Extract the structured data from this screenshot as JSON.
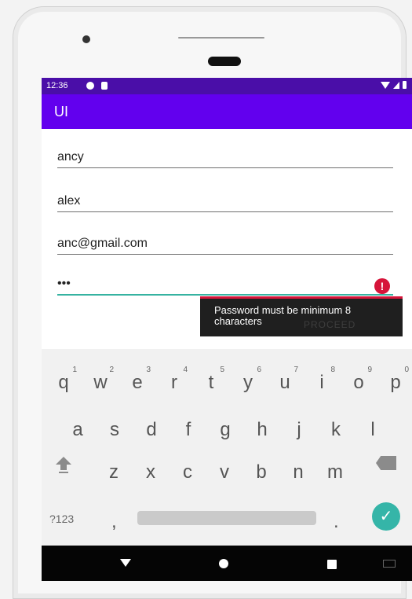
{
  "status_bar": {
    "time": "12:36"
  },
  "app_bar": {
    "title": "UI"
  },
  "form": {
    "fields": [
      {
        "value": "ancy"
      },
      {
        "value": "alex"
      },
      {
        "value": "anc@gmail.com"
      },
      {
        "value": "•••"
      }
    ],
    "error_message": "Password must be minimum 8 characters",
    "button_label": "PROCEED"
  },
  "keyboard": {
    "row1": [
      "q",
      "w",
      "e",
      "r",
      "t",
      "y",
      "u",
      "i",
      "o",
      "p"
    ],
    "row1_hints": [
      "1",
      "2",
      "3",
      "4",
      "5",
      "6",
      "7",
      "8",
      "9",
      "0"
    ],
    "row2": [
      "a",
      "s",
      "d",
      "f",
      "g",
      "h",
      "j",
      "k",
      "l"
    ],
    "row3": [
      "z",
      "x",
      "c",
      "v",
      "b",
      "n",
      "m"
    ],
    "symbols_label": "?123",
    "comma_label": ",",
    "period_label": ".",
    "done_label": "✓"
  }
}
